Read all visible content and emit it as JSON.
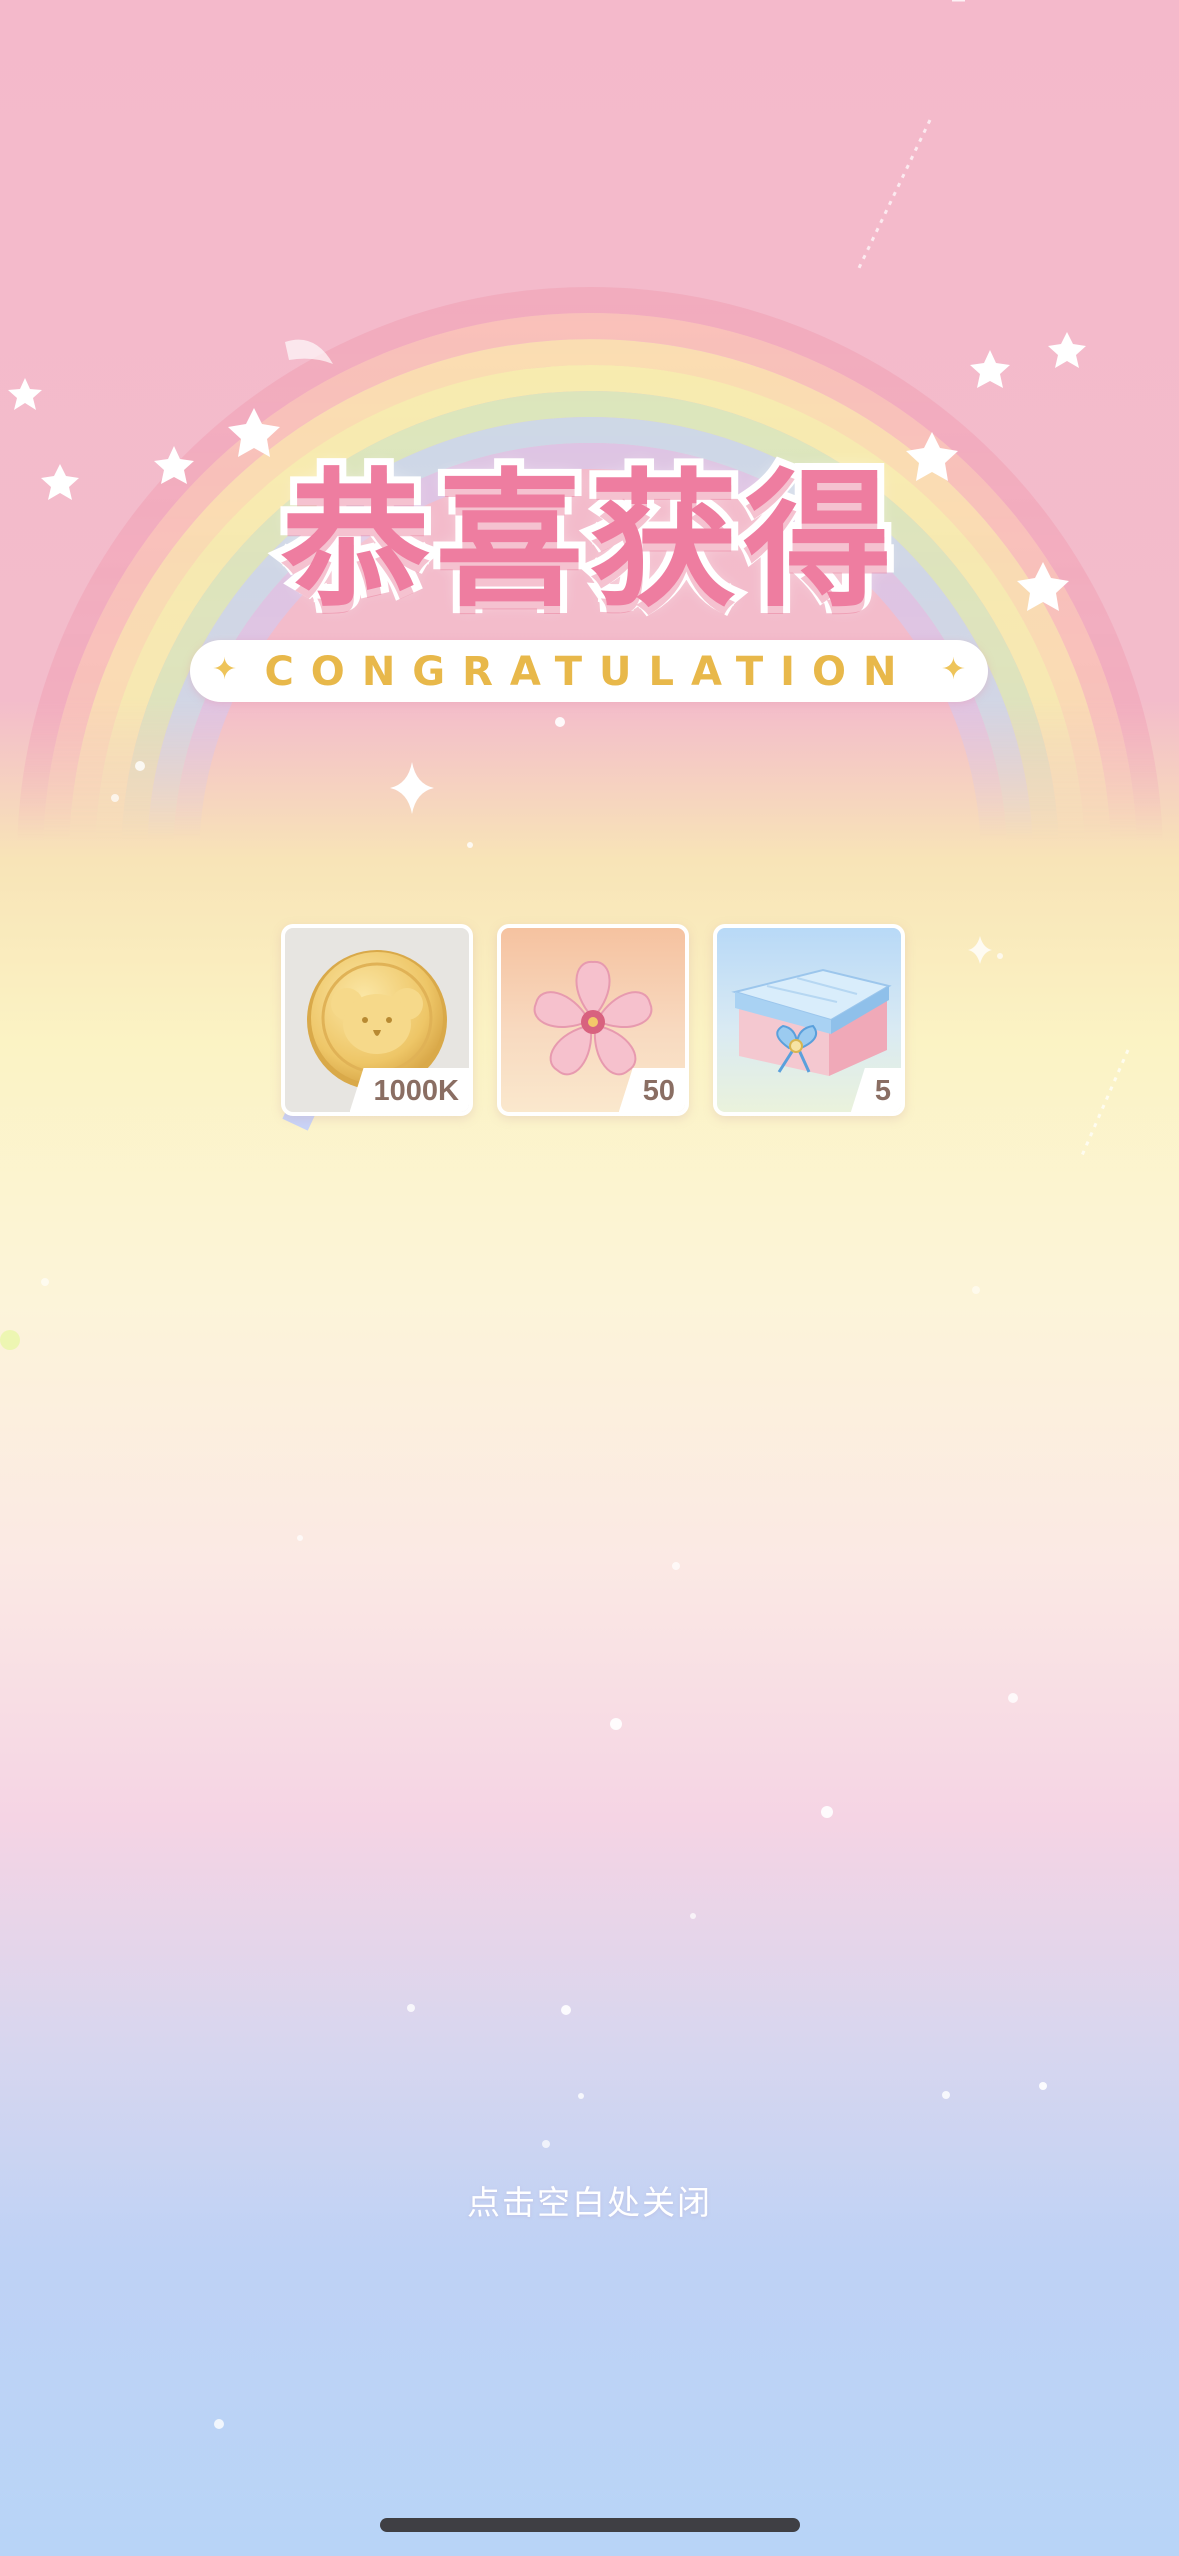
{
  "header": {
    "title": "恭喜获得",
    "subtitle": "CONGRATULATION"
  },
  "rewards": [
    {
      "name": "coin",
      "quantity": "1000K"
    },
    {
      "name": "sakura-flower",
      "quantity": "50"
    },
    {
      "name": "gift-box",
      "quantity": "5"
    }
  ],
  "footer": {
    "close_hint": "点击空白处关闭"
  },
  "colors": {
    "title": "#ee7da0",
    "subtitle": "#e8b84a",
    "top_bg": "#f4b9cb",
    "bottom_bg": "#b8d4f7"
  }
}
